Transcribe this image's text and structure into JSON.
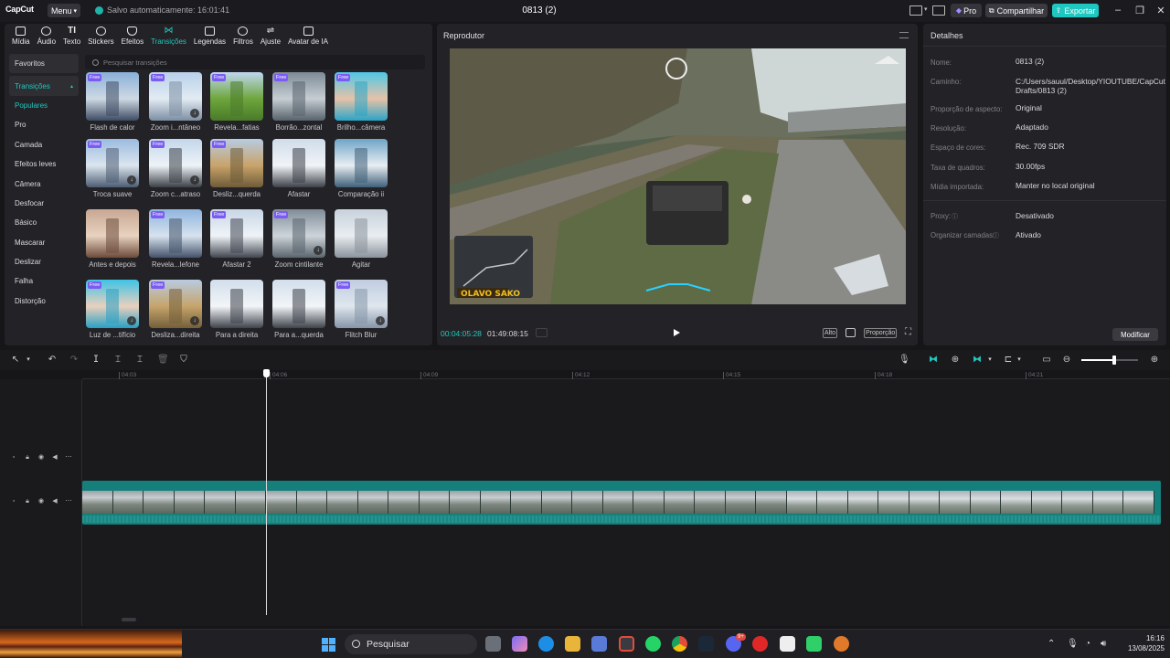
{
  "titlebar": {
    "logo": "CapCut",
    "menu_label": "Menu",
    "autosave": "Salvo automaticamente: 16:01:41",
    "project_title": "0813 (2)",
    "pro_label": "Pro",
    "share_label": "Compartilhar",
    "export_label": "Exportar"
  },
  "tool_tabs": [
    {
      "label": "Mídia"
    },
    {
      "label": "Áudio"
    },
    {
      "label": "Texto"
    },
    {
      "label": "Stickers"
    },
    {
      "label": "Efeitos"
    },
    {
      "label": "Transições",
      "active": true
    },
    {
      "label": "Legendas"
    },
    {
      "label": "Filtros"
    },
    {
      "label": "Ajuste"
    },
    {
      "label": "Avatar de IA"
    }
  ],
  "categories": [
    "Favoritos",
    "Transições",
    "Populares",
    "Pro",
    "Camada",
    "Efeitos leves",
    "Câmera",
    "Desfocar",
    "Básico",
    "Mascarar",
    "Deslizar",
    "Falha",
    "Distorção"
  ],
  "search_placeholder": "Pesquisar transições",
  "free_badge": "Free",
  "transitions": [
    {
      "label": "Flash de calor",
      "free": true,
      "download": false,
      "colors": [
        "#8ab0d8",
        "#cfd9e4",
        "#3d4b63"
      ]
    },
    {
      "label": "Zoom i...ntâneo",
      "free": true,
      "download": true,
      "colors": [
        "#b9d1ea",
        "#e2ebf3",
        "#7c8ea3"
      ]
    },
    {
      "label": "Revela...fatias",
      "free": true,
      "download": false,
      "colors": [
        "#bfd8ef",
        "#6ea63c",
        "#4a7a2a"
      ]
    },
    {
      "label": "Borrão...zontal",
      "free": true,
      "download": false,
      "colors": [
        "#7d8b97",
        "#c7ced4",
        "#57626b"
      ]
    },
    {
      "label": "Brilho...câmera",
      "free": true,
      "download": false,
      "colors": [
        "#4ec7e6",
        "#e7c2a8",
        "#2aa5c7"
      ]
    },
    {
      "label": "Troca suave",
      "free": true,
      "download": true,
      "colors": [
        "#9bbbe0",
        "#dbe5ee",
        "#4c5c72"
      ]
    },
    {
      "label": "Zoom c...atraso",
      "free": true,
      "download": true,
      "colors": [
        "#c3d6ea",
        "#eef3f8",
        "#3b3f47"
      ]
    },
    {
      "label": "Desliz...querda",
      "free": true,
      "download": false,
      "colors": [
        "#b7cce2",
        "#c9a36a",
        "#6e5b38"
      ]
    },
    {
      "label": "Afastar",
      "free": false,
      "download": false,
      "colors": [
        "#d0dcea",
        "#f1f4f7",
        "#3c4048"
      ]
    },
    {
      "label": "Comparação ii",
      "free": false,
      "download": false,
      "colors": [
        "#6fa4c8",
        "#e8eef2",
        "#3e5f79"
      ]
    },
    {
      "label": "Antes e depois",
      "free": false,
      "download": false,
      "colors": [
        "#c7a793",
        "#e8d2c0",
        "#6c4a3a"
      ]
    },
    {
      "label": "Revela...lefone",
      "free": true,
      "download": false,
      "colors": [
        "#8fb5de",
        "#d6e2ee",
        "#44526a"
      ]
    },
    {
      "label": "Afastar 2",
      "free": true,
      "download": false,
      "colors": [
        "#c8d7e7",
        "#eff3f7",
        "#404650"
      ]
    },
    {
      "label": "Zoom cintilante",
      "free": true,
      "download": true,
      "colors": [
        "#7f8c98",
        "#ced5da",
        "#5a646d"
      ]
    },
    {
      "label": "Agitar",
      "free": false,
      "download": false,
      "colors": [
        "#c8d2dc",
        "#e9edf1",
        "#8a929b"
      ]
    },
    {
      "label": "Luz de ...tifício",
      "free": true,
      "download": true,
      "colors": [
        "#3ec3e6",
        "#ead0bd",
        "#28a0c4"
      ]
    },
    {
      "label": "Desliza...direita",
      "free": true,
      "download": true,
      "colors": [
        "#b9cbe0",
        "#c6a46b",
        "#745f3a"
      ]
    },
    {
      "label": "Para a direita",
      "free": false,
      "download": false,
      "colors": [
        "#d2deeb",
        "#f2f5f8",
        "#3e424a"
      ]
    },
    {
      "label": "Para a...querda",
      "free": false,
      "download": false,
      "colors": [
        "#d2deeb",
        "#f2f5f8",
        "#3e424a"
      ]
    },
    {
      "label": "Flitch Blur",
      "free": true,
      "download": true,
      "colors": [
        "#c0cde0",
        "#dfe6ee",
        "#8595a8"
      ]
    }
  ],
  "player": {
    "title": "Reprodutor",
    "timecode_current": "00:04:05:28",
    "timecode_total": "01:49:08:15",
    "ratio_label": "Proporção",
    "quality_label": "Alto",
    "video_overlay_text": "OLAVO SAKO"
  },
  "details": {
    "title": "Detalhes",
    "rows": [
      {
        "key": "Nome:",
        "value": "0813 (2)"
      },
      {
        "key": "Caminho:",
        "value": "C:/Users/sauul/Desktop/YIOUTUBE/CapCut Drafts/0813 (2)"
      },
      {
        "key": "Proporção de aspecto:",
        "value": "Original"
      },
      {
        "key": "Resolução:",
        "value": "Adaptado"
      },
      {
        "key": "Espaço de cores:",
        "value": "Rec. 709 SDR"
      },
      {
        "key": "Taxa de quadros:",
        "value": "30.00fps"
      },
      {
        "key": "Mídia importada:",
        "value": "Manter no local original"
      },
      {
        "key": "Proxy:",
        "value": "Desativado"
      },
      {
        "key": "Organizar camadas:",
        "value": "Ativado"
      }
    ],
    "modify_label": "Modificar"
  },
  "timeline": {
    "ticks": [
      "04:03",
      "04:06",
      "04:09",
      "04:12",
      "04:15",
      "04:18",
      "04:21"
    ],
    "zoom_level": 0.58
  },
  "taskbar": {
    "search_label": "Pesquisar",
    "time": "16:16",
    "date": "13/08/2025",
    "notification_badge": "9+"
  },
  "colors": {
    "accent": "#21c8c0",
    "export": "#1ec8c0",
    "free_badge": "#7a5cf2"
  }
}
